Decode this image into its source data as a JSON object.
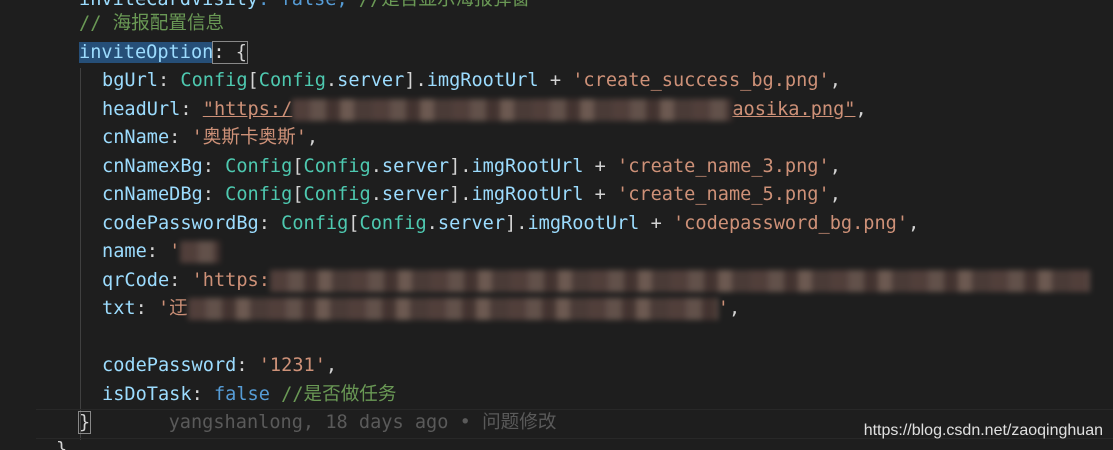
{
  "lines": {
    "l0_key": "inviteCardVisity",
    "l0_rest": ": false, ",
    "l0_comment": "//是否显示海报弹窗",
    "l1_comment": "// 海报配置信息",
    "l2_key": "inviteOption",
    "l2_rest": ": {",
    "l3_key": "bgUrl",
    "l3_value": "'create_success_bg.png'",
    "l4_key": "headUrl",
    "l4_value_start": "\"https:/",
    "l4_value_end": "aosika.png\"",
    "l5_key": "cnName",
    "l5_value": "'奥斯卡奥斯'",
    "l6_key": "cnNamexBg",
    "l6_value": "'create_name_3.png'",
    "l7_key": "cnNameDBg",
    "l7_value": "'create_name_5.png'",
    "l8_key": "codePasswordBg",
    "l8_value": "'codepassword_bg.png'",
    "l9_key": "name",
    "l10_key": "qrCode",
    "l10_value_start": "'https:",
    "l11_key": "txt",
    "l11_value_start": "'迂",
    "l13_key": "codePassword",
    "l13_value": "'1231'",
    "l14_key": "isDoTask",
    "l14_bool": "false",
    "l14_comment": "//是否做任务",
    "l15_brace": "}",
    "l16_brace": "},"
  },
  "config_expr": {
    "config": "Config",
    "server_config": "Config",
    "server": "server",
    "img_root": "imgRootUrl"
  },
  "blame": {
    "author": "yangshanlong",
    "time": "18 days ago",
    "separator": "•",
    "message": "问题修改"
  },
  "watermark": "https://blog.csdn.net/zaoqinghuan",
  "colors": {
    "background": "#1e1e1e",
    "key": "#9cdcfe",
    "type": "#4ec9b0",
    "string": "#ce9178",
    "comment": "#6a9955",
    "boolean": "#569cd6"
  }
}
